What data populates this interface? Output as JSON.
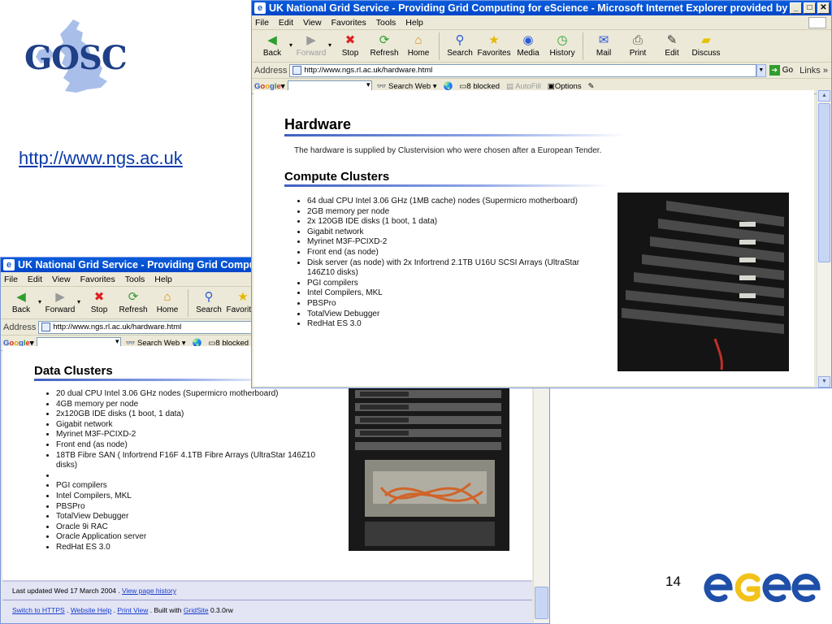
{
  "slide": {
    "logo_text": "GOSC",
    "link": "http://www.ngs.ac.uk",
    "page_number": "14",
    "egee_logo_text": "eGee"
  },
  "win_hardware": {
    "title": "UK National Grid Service - Providing Grid Computing for eScience - Microsoft Internet Explorer provided by CCLRC",
    "menu": [
      "File",
      "Edit",
      "View",
      "Favorites",
      "Tools",
      "Help"
    ],
    "toolbar": [
      {
        "label": "Back",
        "icon": "back-arrow-icon"
      },
      {
        "label": "Forward",
        "icon": "forward-arrow-icon"
      },
      {
        "label": "Stop",
        "icon": "stop-icon"
      },
      {
        "label": "Refresh",
        "icon": "refresh-icon"
      },
      {
        "label": "Home",
        "icon": "home-icon"
      },
      {
        "label": "Search",
        "icon": "search-icon"
      },
      {
        "label": "Favorites",
        "icon": "star-icon"
      },
      {
        "label": "Media",
        "icon": "media-icon"
      },
      {
        "label": "History",
        "icon": "history-icon"
      },
      {
        "label": "Mail",
        "icon": "mail-icon"
      },
      {
        "label": "Print",
        "icon": "print-icon"
      },
      {
        "label": "Edit",
        "icon": "edit-icon"
      },
      {
        "label": "Discuss",
        "icon": "discuss-icon"
      }
    ],
    "address_label": "Address",
    "address": "http://www.ngs.rl.ac.uk/hardware.html",
    "go_label": "Go",
    "links_label": "Links",
    "google_bar": {
      "google": "Google",
      "search_web": "Search Web",
      "blocked": "8 blocked",
      "autofill": "AutoFill",
      "options": "Options"
    },
    "page": {
      "heading": "Hardware",
      "intro": "The hardware is supplied by Clustervision who were chosen after a European Tender.",
      "subheading": "Compute Clusters",
      "items": [
        "64 dual CPU Intel 3.06 GHz (1MB cache) nodes (Supermicro motherboard)",
        "2GB memory per node",
        "2x 120GB IDE disks (1 boot, 1 data)",
        "Gigabit network",
        "Myrinet M3F-PCIXD-2",
        "Front end (as node)",
        "Disk server (as node) with 2x Infortrend 2.1TB U16U SCSI Arrays (UltraStar 146Z10 disks)",
        "PGI compilers",
        "Intel Compilers, MKL",
        "PBSPro",
        "TotalView Debugger",
        "RedHat ES 3.0"
      ]
    }
  },
  "win_data": {
    "title": "UK National Grid Service - Providing Grid Computing f",
    "menu": [
      "File",
      "Edit",
      "View",
      "Favorites",
      "Tools",
      "Help"
    ],
    "toolbar": [
      {
        "label": "Back",
        "icon": "back-arrow-icon"
      },
      {
        "label": "Forward",
        "icon": "forward-arrow-icon"
      },
      {
        "label": "Stop",
        "icon": "stop-icon"
      },
      {
        "label": "Refresh",
        "icon": "refresh-icon"
      },
      {
        "label": "Home",
        "icon": "home-icon"
      },
      {
        "label": "Search",
        "icon": "search-icon"
      },
      {
        "label": "Favorites",
        "icon": "star-icon"
      }
    ],
    "address_label": "Address",
    "address": "http://www.ngs.rl.ac.uk/hardware.html",
    "google_bar": {
      "google": "Google",
      "search_web": "Search Web",
      "blocked": "8 blocked"
    },
    "page": {
      "subheading": "Data Clusters",
      "items": [
        "20 dual CPU Intel 3.06 GHz nodes (Supermicro motherboard)",
        "4GB memory per node",
        "2x120GB IDE disks (1 boot, 1 data)",
        "Gigabit network",
        "Myrinet M3F-PCIXD-2",
        "Front end (as node)",
        "18TB Fibre SAN ( Infortrend F16F 4.1TB Fibre Arrays (UltraStar 146Z10 disks)",
        "",
        "PGI compilers",
        "Intel Compilers, MKL",
        "PBSPro",
        "TotalView Debugger",
        "Oracle 9i RAC",
        "Oracle Application server",
        "RedHat ES 3.0"
      ],
      "footer": {
        "updated": "Last updated Wed 17 March 2004 .",
        "history_link": "View page history",
        "https_link": "Switch to HTTPS",
        "sep1": " . ",
        "help_link": "Website Help",
        "sep2": " . ",
        "print_link": "Print View",
        "built_with": " . Built with ",
        "gridsite_link": "GridSite",
        "version": " 0.3.0rw"
      }
    }
  }
}
